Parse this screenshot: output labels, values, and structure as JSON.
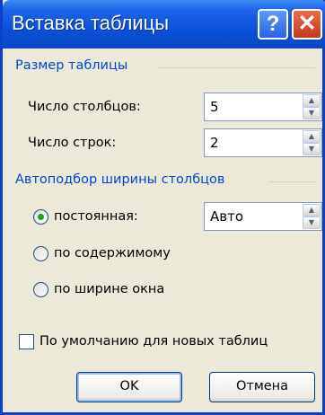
{
  "dialog": {
    "title": "Вставка таблицы",
    "help_glyph": "?",
    "close_glyph": "✕"
  },
  "table_size": {
    "group_label": "Размер таблицы",
    "columns_label": "Число столбцов:",
    "columns_value": "5",
    "rows_label": "Число строк:",
    "rows_value": "2"
  },
  "autofit": {
    "group_label": "Автоподбор ширины столбцов",
    "fixed_label": "постоянная:",
    "fixed_value": "Авто",
    "contents_label": "по содержимому",
    "window_label": "по ширине окна",
    "selected": "fixed"
  },
  "default_checkbox": {
    "label": "По умолчанию для новых таблиц",
    "checked": false
  },
  "buttons": {
    "ok": "OK",
    "cancel": "Отмена"
  },
  "spinner_arrows": {
    "up": "▲",
    "down": "▼"
  }
}
